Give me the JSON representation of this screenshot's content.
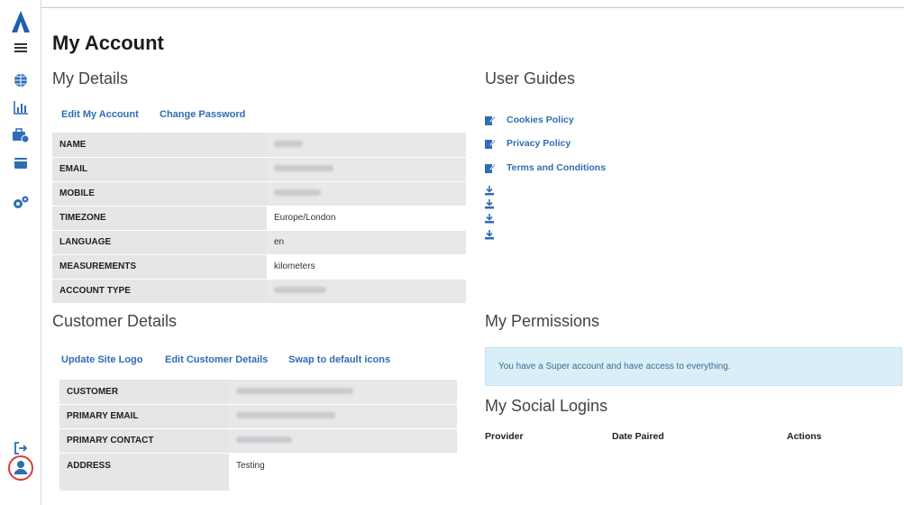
{
  "colors": {
    "accent": "#2f6db5",
    "alert_bg": "#d9eef8",
    "user_circle": "#d93a3a"
  },
  "sidebar": {
    "items": [
      {
        "icon": "logo-a-icon"
      },
      {
        "icon": "menu-icon"
      },
      {
        "icon": "globe-icon"
      },
      {
        "icon": "bar-chart-icon"
      },
      {
        "icon": "toolbox-icon"
      },
      {
        "icon": "wallet-icon"
      },
      {
        "icon": "gears-icon"
      },
      {
        "icon": "logout-icon"
      },
      {
        "icon": "user-icon"
      }
    ]
  },
  "page": {
    "title": "My Account"
  },
  "my_details": {
    "title": "My Details",
    "actions": [
      "Edit My Account",
      "Change Password"
    ],
    "rows": [
      {
        "label": "NAME",
        "value": ""
      },
      {
        "label": "EMAIL",
        "value": ""
      },
      {
        "label": "MOBILE",
        "value": ""
      },
      {
        "label": "TIMEZONE",
        "value": "Europe/London"
      },
      {
        "label": "LANGUAGE",
        "value": "en"
      },
      {
        "label": "MEASUREMENTS",
        "value": "kilometers"
      },
      {
        "label": "ACCOUNT TYPE",
        "value": ""
      }
    ]
  },
  "customer_details": {
    "title": "Customer Details",
    "actions": [
      "Update Site Logo",
      "Edit Customer Details",
      "Swap to default icons"
    ],
    "rows": [
      {
        "label": "CUSTOMER",
        "value": ""
      },
      {
        "label": "PRIMARY EMAIL",
        "value": ""
      },
      {
        "label": "PRIMARY CONTACT",
        "value": ""
      },
      {
        "label": "ADDRESS",
        "value": "Testing"
      }
    ]
  },
  "user_guides": {
    "title": "User Guides",
    "links": [
      "Cookies Policy",
      "Privacy Policy",
      "Terms and Conditions"
    ],
    "download_count": 4
  },
  "permissions": {
    "title": "My Permissions",
    "message": "You have a Super account and have access to everything."
  },
  "social_logins": {
    "title": "My Social Logins",
    "columns": [
      "Provider",
      "Date Paired",
      "Actions"
    ]
  }
}
